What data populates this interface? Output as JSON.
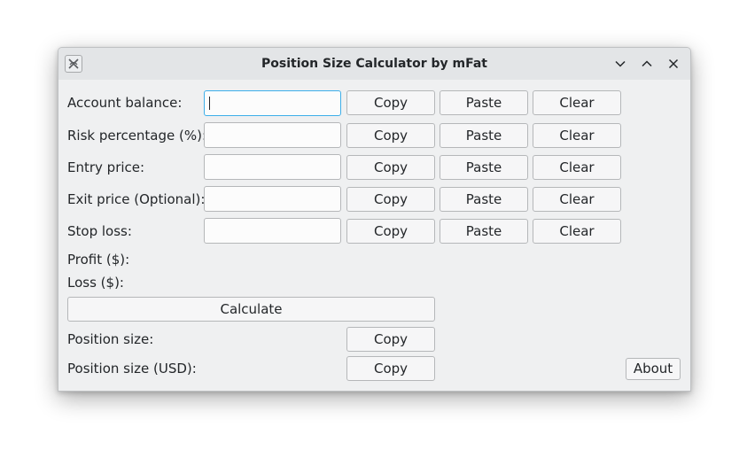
{
  "window": {
    "title": "Position Size Calculator by mFat"
  },
  "icons": {
    "app": "app-logo-icon",
    "minimize": "chevron-down-icon",
    "maximize": "chevron-up-icon",
    "close": "close-icon"
  },
  "fields": [
    {
      "label": "Account balance:",
      "value": "",
      "copy": "Copy",
      "paste": "Paste",
      "clear": "Clear"
    },
    {
      "label": "Risk percentage (%):",
      "value": "",
      "copy": "Copy",
      "paste": "Paste",
      "clear": "Clear"
    },
    {
      "label": "Entry price:",
      "value": "",
      "copy": "Copy",
      "paste": "Paste",
      "clear": "Clear"
    },
    {
      "label": "Exit price (Optional):",
      "value": "",
      "copy": "Copy",
      "paste": "Paste",
      "clear": "Clear"
    },
    {
      "label": "Stop loss:",
      "value": "",
      "copy": "Copy",
      "paste": "Paste",
      "clear": "Clear"
    }
  ],
  "results": {
    "profit_label": "Profit ($):",
    "loss_label": "Loss ($):",
    "calculate_label": "Calculate",
    "position_size_label": "Position size:",
    "position_size_copy": "Copy",
    "position_size_usd_label": "Position size (USD):",
    "position_size_usd_copy": "Copy",
    "about_label": "About"
  },
  "colors": {
    "window_bg": "#eff0f1",
    "titlebar_bg": "#e3e5e7",
    "focus_border": "#3daee9",
    "text": "#232629"
  }
}
